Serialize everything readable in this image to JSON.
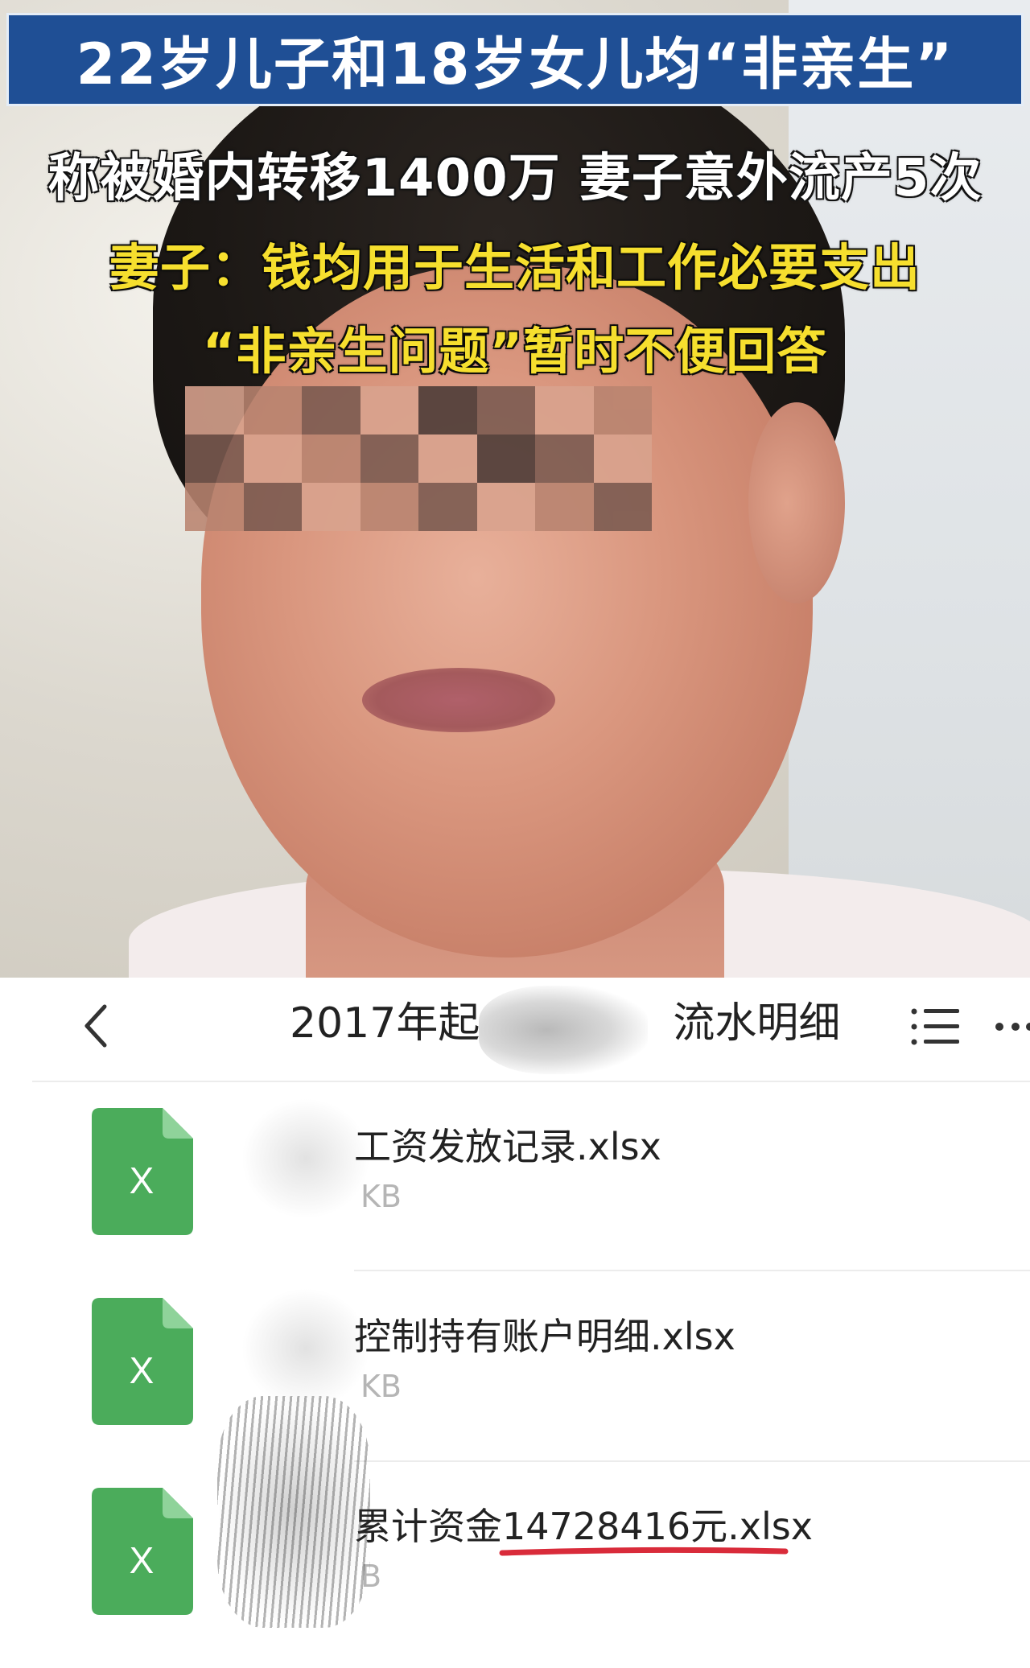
{
  "news": {
    "headline": "22岁儿子和18岁女儿均“非亲生”",
    "subtitle": "称被婚内转移1400万 妻子意外流产5次",
    "wife_quote_line1": "妻子：钱均用于生活和工作必要支出",
    "wife_quote_line2": "“非亲生问题”暂时不便回答",
    "colors": {
      "banner": "#1f4f95",
      "quote_text": "#f6df2e"
    }
  },
  "app": {
    "nav": {
      "back_icon": "chevron-left-icon",
      "title": "2017年起",
      "title_suffix": "流水明细",
      "menu_icon": "list-icon",
      "more_icon": "more-horizontal-icon"
    },
    "files": [
      {
        "name": "工资发放记录.xlsx",
        "size": "KB",
        "icon": "excel-file-icon",
        "icon_letter": "X"
      },
      {
        "name": "控制持有账户明细.xlsx",
        "size": "KB",
        "icon": "excel-file-icon",
        "icon_letter": "X"
      },
      {
        "name_prefix": "累计资金",
        "name_amount": "14728416元.xlsx",
        "size": "B",
        "icon": "excel-file-icon",
        "icon_letter": "X"
      }
    ],
    "colors": {
      "excel_green": "#4bac5b",
      "underline_red": "#d92b3a"
    }
  }
}
